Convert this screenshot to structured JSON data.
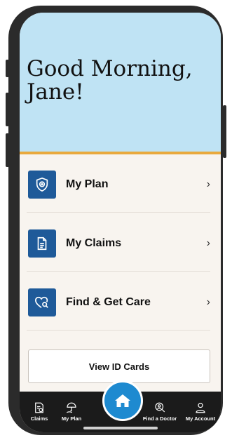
{
  "greeting": "Good Morning, Jane!",
  "menu": [
    {
      "label": "My Plan",
      "icon": "shield-plus-icon"
    },
    {
      "label": "My Claims",
      "icon": "document-icon"
    },
    {
      "label": "Find & Get Care",
      "icon": "heart-search-icon"
    }
  ],
  "id_cards_label": "View ID Cards",
  "tabs": [
    {
      "label": "Claims",
      "icon": "claims-icon"
    },
    {
      "label": "My Plan",
      "icon": "umbrella-hand-icon"
    },
    {
      "label": "Find a Doctor",
      "icon": "doctor-search-icon"
    },
    {
      "label": "My Account",
      "icon": "person-icon"
    }
  ],
  "colors": {
    "hero": "#bfe3f4",
    "accent": "#e9a93d",
    "icon_tile": "#1f5a99",
    "home_button": "#1e8ad0",
    "tabbar": "#1b1b1b"
  }
}
